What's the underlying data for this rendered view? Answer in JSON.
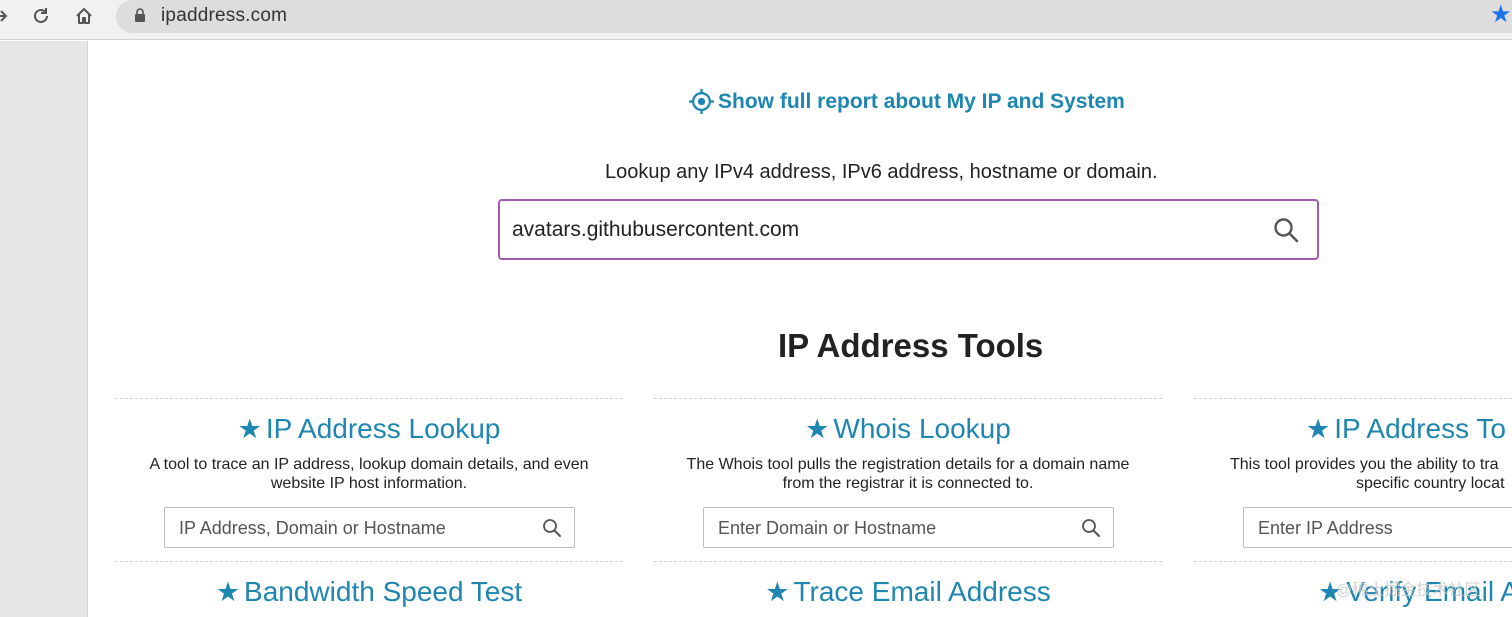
{
  "browser": {
    "url": "ipaddress.com"
  },
  "page": {
    "report_link": "Show full report about My IP and System",
    "lookup_intro": "Lookup any IPv4 address, IPv6 address, hostname or domain.",
    "main_search_value": "avatars.githubusercontent.com",
    "tools_title": "IP Address Tools",
    "tools": [
      {
        "title": "IP Address Lookup",
        "desc_line1": "A tool to trace an IP address, lookup domain details, and even",
        "desc_line2": "website IP host information.",
        "placeholder": "IP Address, Domain or Hostname"
      },
      {
        "title": "Whois Lookup",
        "desc_line1": "The Whois tool pulls the registration details for a domain name",
        "desc_line2": "from the registrar it is connected to.",
        "placeholder": "Enter Domain or Hostname"
      },
      {
        "title": "IP Address To C",
        "desc_line1": "This tool provides you the ability to tra",
        "desc_line2": "specific country locat",
        "placeholder": "Enter IP Address"
      }
    ],
    "tools_row2": [
      {
        "title": "Bandwidth Speed Test"
      },
      {
        "title": "Trace Email Address"
      },
      {
        "title": "Verify Email Ac"
      }
    ],
    "watermark": "@稀土掘金技术社区"
  },
  "colors": {
    "link": "#1e86b0",
    "search_border": "#a05bb1"
  }
}
